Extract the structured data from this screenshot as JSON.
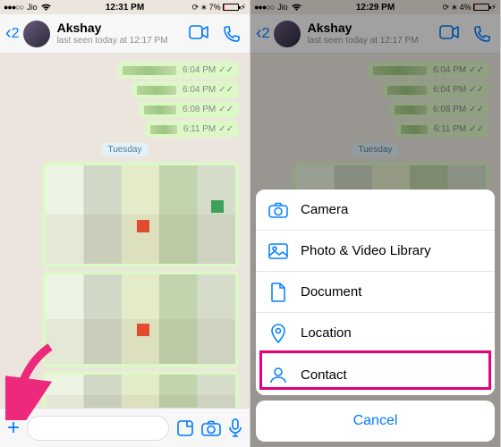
{
  "left": {
    "status": {
      "carrier": "Jio",
      "time": "12:31 PM",
      "battery_pct": "7%"
    },
    "nav": {
      "back_count": "2",
      "title": "Akshay",
      "subtitle": "last seen today at 12:17 PM"
    },
    "bubbles": {
      "t1": "6:04 PM",
      "t2": "6:04 PM",
      "t3": "6:08 PM",
      "t4": "6:11 PM"
    },
    "day_chip": "Tuesday"
  },
  "right": {
    "status": {
      "carrier": "Jio",
      "time": "12:29 PM",
      "battery_pct": "4%"
    },
    "nav": {
      "back_count": "2",
      "title": "Akshay",
      "subtitle": "last seen today at 12:17 PM"
    },
    "bubbles": {
      "t1": "6:04 PM",
      "t2": "6:04 PM",
      "t3": "6:08 PM",
      "t4": "6:11 PM"
    },
    "day_chip": "Tuesday",
    "sheet": {
      "items": {
        "camera": "Camera",
        "photo": "Photo & Video Library",
        "document": "Document",
        "location": "Location",
        "contact": "Contact"
      },
      "cancel": "Cancel"
    }
  }
}
